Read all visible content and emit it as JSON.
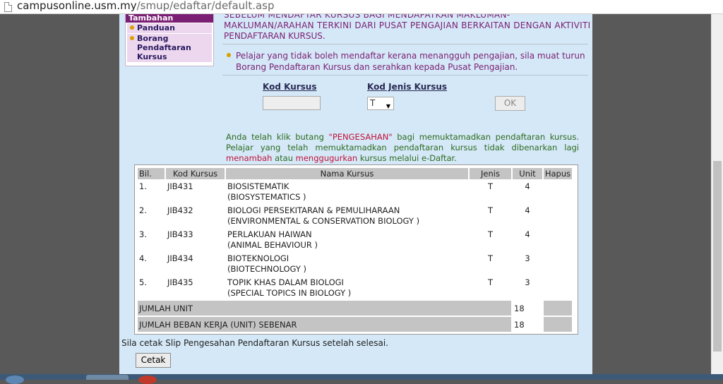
{
  "browser": {
    "url_host": "campusonline.usm.my",
    "url_path": "/smup/edaftar/default.asp"
  },
  "sidebar": {
    "header": "Tambahan",
    "items": [
      {
        "label": "Panduan"
      },
      {
        "label_lines": [
          "Borang",
          "Pendaftaran",
          "Kursus"
        ]
      }
    ]
  },
  "notices": {
    "top_line1": "SEBELUM MENDAFTAR KURSUS BAGI MENDAPATKAN MAKLUMAN-",
    "top_line2": "MAKLUMAN/ARAHAN TERKINI DARI PUSAT PENGAJIAN BERKAITAN DENGAN AKTIVITI",
    "top_line3": "PENDAFTARAN KURSUS.",
    "deferred_students": "Pelajar yang tidak boleh mendaftar kerana menangguh pengajian, sila muat turun Borang Pendaftaran Kursus dan serahkan kepada Pusat Pengajian.",
    "confirm_part1": "Anda telah klik butang ",
    "confirm_highlight1": "\"PENGESAHAN\"",
    "confirm_part2": " bagi memuktamadkan pendaftaran kursus. Pelajar yang telah memuktamadkan pendaftaran kursus tidak dibenarkan lagi ",
    "confirm_highlight2": "menambah",
    "confirm_part3": " atau ",
    "confirm_highlight3": "menggugurkan",
    "confirm_part4": " kursus melalui e-Daftar."
  },
  "form": {
    "kod_kursus_label": "Kod Kursus",
    "kod_kursus_value": "",
    "kod_jenis_label": "Kod Jenis Kursus",
    "kod_jenis_value": "T",
    "ok_label": "OK"
  },
  "table": {
    "headers": [
      "Bil.",
      "Kod Kursus",
      "Nama Kursus",
      "Jenis",
      "Unit",
      "Hapus"
    ],
    "rows": [
      {
        "bil": "1.",
        "kod": "JIB431",
        "nama_ms": "BIOSISTEMATIK",
        "nama_en": "(BIOSYSTEMATICS )",
        "jenis": "T",
        "unit": "4"
      },
      {
        "bil": "2.",
        "kod": "JIB432",
        "nama_ms": "BIOLOGI PERSEKITARAN & PEMULIHARAAN",
        "nama_en": "(ENVIRONMENTAL & CONSERVATION BIOLOGY )",
        "jenis": "T",
        "unit": "4"
      },
      {
        "bil": "3.",
        "kod": "JIB433",
        "nama_ms": "PERLAKUAN HAIWAN",
        "nama_en": "(ANIMAL BEHAVIOUR )",
        "jenis": "T",
        "unit": "4"
      },
      {
        "bil": "4.",
        "kod": "JIB434",
        "nama_ms": "BIOTEKNOLOGI",
        "nama_en": "(BIOTECHNOLOGY )",
        "jenis": "T",
        "unit": "3"
      },
      {
        "bil": "5.",
        "kod": "JIB435",
        "nama_ms": "TOPIK KHAS DALAM BIOLOGI",
        "nama_en": "(SPECIAL TOPICS IN BIOLOGY )",
        "jenis": "T",
        "unit": "3"
      }
    ],
    "total_units_label": "JUMLAH UNIT",
    "total_units_value": "18",
    "actual_load_label": "JUMLAH BEBAN KERJA (UNIT) SEBENAR",
    "actual_load_value": "18"
  },
  "footer": {
    "slip_note": "Sila cetak Slip Pengesahan Pendaftaran Kursus setelah selesai.",
    "print_label": "Cetak"
  },
  "colors": {
    "page_bg": "#d4e8f7",
    "purple_text": "#7a1f73",
    "green_text": "#2e6b1f",
    "red_text": "#c2123a",
    "bullet": "#d8a000",
    "header_grey": "#c4c4c4"
  }
}
